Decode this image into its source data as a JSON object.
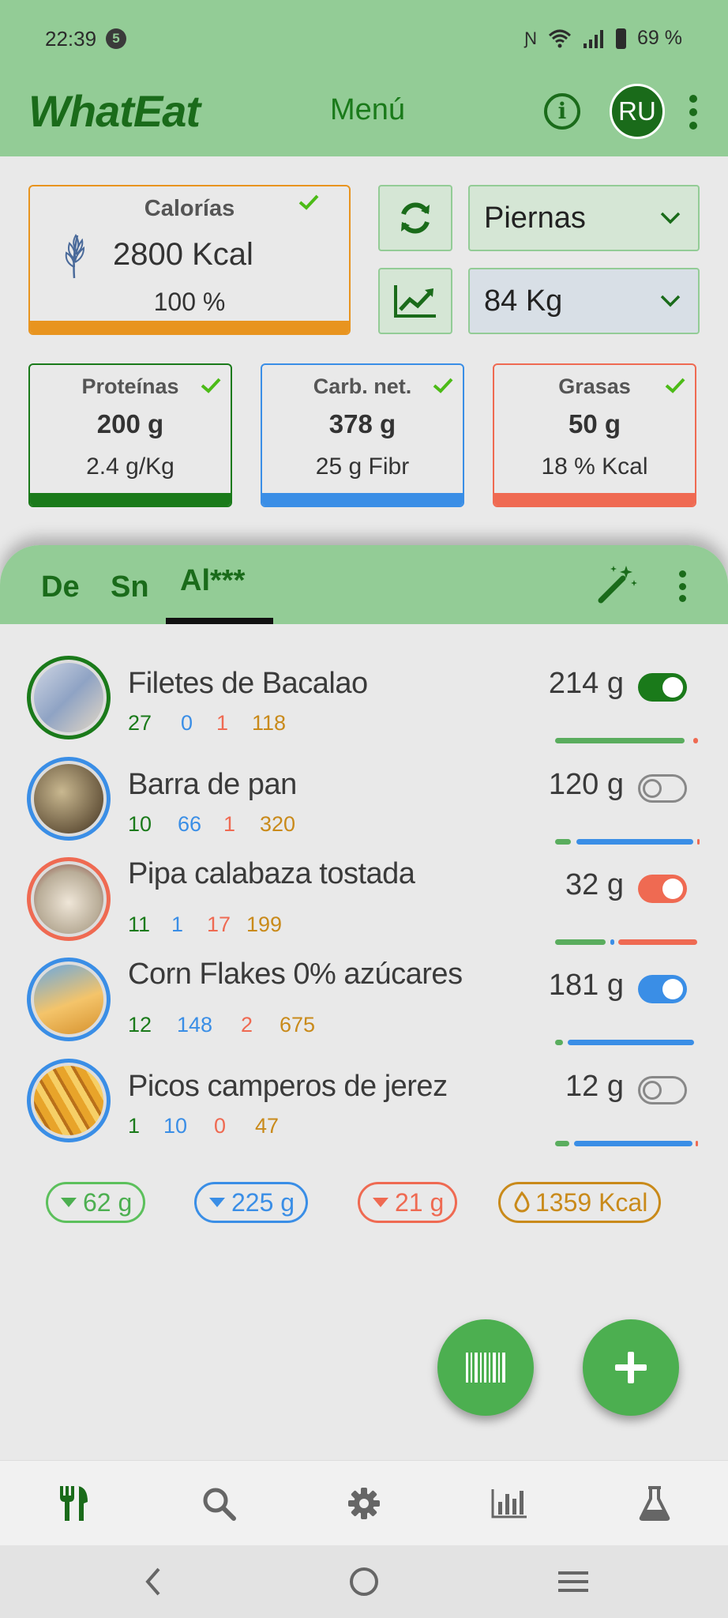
{
  "status_bar": {
    "time": "22:39",
    "notification_count": "5",
    "battery": "69 %"
  },
  "app_bar": {
    "title": "WhatEat",
    "menu_label": "Menú",
    "avatar_initials": "RU"
  },
  "calories": {
    "title": "Calorías",
    "value": "2800 Kcal",
    "percent": "100 %",
    "progress": 1.0,
    "color": "#e8941f"
  },
  "controls": {
    "routine_select": "Piernas",
    "weight_select": "84 Kg"
  },
  "macros": [
    {
      "title": "Proteínas",
      "value": "200 g",
      "sub": "2.4 g/Kg",
      "color": "#1a7a1a"
    },
    {
      "title": "Carb. net.",
      "value": "378 g",
      "sub": "25 g Fibr",
      "color": "#3a8ee6"
    },
    {
      "title": "Grasas",
      "value": "50 g",
      "sub": "18 % Kcal",
      "color": "#ef6a52"
    }
  ],
  "tabs": [
    {
      "label": "De"
    },
    {
      "label": "Sn"
    },
    {
      "label": "Al***",
      "active": true
    }
  ],
  "foods": [
    {
      "name": "Filetes de Bacalao",
      "protein": "27",
      "carbs": "0",
      "fat": "1",
      "kcal": "118",
      "grams": "214 g",
      "toggle": "on",
      "toggle_color": "#1a7a1a",
      "ring_color": "#1a7a1a"
    },
    {
      "name": "Barra de pan",
      "protein": "10",
      "carbs": "66",
      "fat": "1",
      "kcal": "320",
      "grams": "120 g",
      "toggle": "off",
      "toggle_color": "#888888",
      "ring_color": "#3a8ee6"
    },
    {
      "name": "Pipa calabaza tostada",
      "protein": "11",
      "carbs": "1",
      "fat": "17",
      "kcal": "199",
      "grams": "32 g",
      "toggle": "on",
      "toggle_color": "#ef6a52",
      "ring_color": "#ef6a52"
    },
    {
      "name": "Corn Flakes 0% azúcares",
      "protein": "12",
      "carbs": "148",
      "fat": "2",
      "kcal": "675",
      "grams": "181 g",
      "toggle": "on",
      "toggle_color": "#3a8ee6",
      "ring_color": "#3a8ee6"
    },
    {
      "name": "Picos camperos de jerez",
      "protein": "1",
      "carbs": "10",
      "fat": "0",
      "kcal": "47",
      "grams": "12 g",
      "toggle": "off",
      "toggle_color": "#888888",
      "ring_color": "#3a8ee6"
    }
  ],
  "totals": {
    "protein": "62 g",
    "carbs": "225 g",
    "fat": "21 g",
    "kcal": "1359 Kcal"
  },
  "colors": {
    "green": "#4caf50",
    "dark_green": "#1a6b1a",
    "blue": "#3a8ee6",
    "red": "#ef6a52",
    "orange": "#c98a1a",
    "header": "#93cc96"
  },
  "bottom_nav": [
    "fork-knife-icon",
    "search-icon",
    "gear-icon",
    "bar-chart-icon",
    "flask-icon"
  ]
}
